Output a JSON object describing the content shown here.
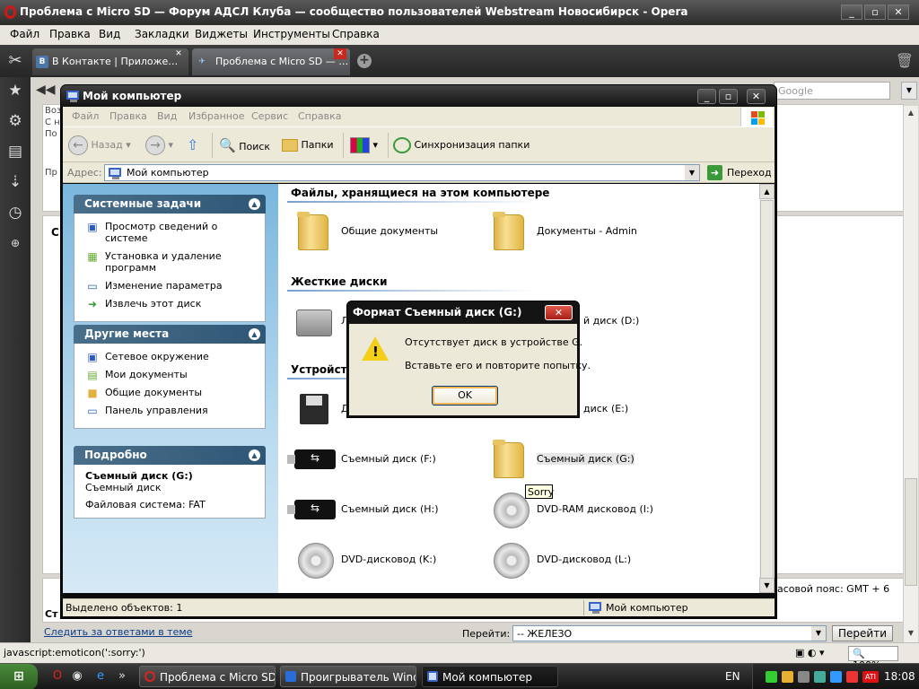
{
  "opera": {
    "title": "Проблема с Micro SD — Форум АДСЛ Клуба — сообщество пользователей Webstream Новосибирск - Opera",
    "window_buttons": [
      "_",
      "▫",
      "✕"
    ],
    "menu": [
      "Файл",
      "Правка",
      "Вид",
      "Закладки",
      "Виджеты",
      "Инструменты",
      "Справка"
    ],
    "tabs": [
      {
        "label": "В Контакте | Приложе…",
        "favicon": "В",
        "active": false
      },
      {
        "label": "Проблема с Micro SD — …",
        "favicon": "✈",
        "active": true
      }
    ],
    "search_placeholder": "Google",
    "status_text": "javascript:emoticon(':sorry:')",
    "zoom": "100%"
  },
  "page": {
    "lines": [
      "Воз",
      "С н",
      "По"
    ],
    "side_label": "Пр",
    "c_label": "С",
    "timezone": "асовой пояс: GMT + 6",
    "st_label": "Ст",
    "follow_link": "Следить за ответами в теме",
    "goto_label": "Перейти:",
    "goto_value": "-- ЖЕЛЕЗО",
    "goto_button": "Перейти"
  },
  "explorer": {
    "title": "Мой компьютер",
    "menu": [
      "Файл",
      "Правка",
      "Вид",
      "Избранное",
      "Сервис",
      "Справка"
    ],
    "toolbar": {
      "back": "Назад",
      "search": "Поиск",
      "folders": "Папки",
      "sync": "Синхронизация папки"
    },
    "address_label": "Адрес:",
    "address_value": "Мой компьютер",
    "go_label": "Переход",
    "tasks_panel": {
      "title": "Системные задачи",
      "items": [
        "Просмотр сведений о системе",
        "Установка и удаление программ",
        "Изменение параметра",
        "Извлечь этот диск"
      ]
    },
    "places_panel": {
      "title": "Другие места",
      "items": [
        "Сетевое окружение",
        "Мои документы",
        "Общие документы",
        "Панель управления"
      ]
    },
    "details_panel": {
      "title": "Подробно",
      "name": "Съемный диск (G:)",
      "type": "Съемный диск",
      "fs": "Файловая система: FAT"
    },
    "groups": {
      "files": "Файлы, хранящиеся на этом компьютере",
      "hdd": "Жесткие диски",
      "removable": "Устройств"
    },
    "items": {
      "shared_docs": "Общие документы",
      "admin_docs": "Документы - Admin",
      "disk_c": "Л",
      "disk_d": "й диск (D:)",
      "floppy": "Д",
      "disk_e": "диск (E:)",
      "disk_f": "Съемный диск (F:)",
      "disk_g": "Съемный диск (G:)",
      "disk_h": "Съемный диск (H:)",
      "drive_i": "DVD-RAM дисковод (I:)",
      "drive_k": "DVD-дисковод (K:)",
      "drive_l": "DVD-дисковод (L:)"
    },
    "tooltip": "Sorry",
    "status_left": "Выделено объектов: 1",
    "status_right": "Мой компьютер"
  },
  "dialog": {
    "title": "Формат Съемный диск (G:)",
    "line1": "Отсутствует диск в устройстве G.",
    "line2": "Вставьте его и повторите попытку.",
    "ok": "OK"
  },
  "taskbar": {
    "tasks": [
      {
        "label": "Проблема с Micro SD …",
        "active": false
      },
      {
        "label": "Проигрыватель Wind…",
        "active": false
      },
      {
        "label": "Мой компьютер",
        "active": true
      }
    ],
    "lang": "EN",
    "time": "18:08"
  }
}
